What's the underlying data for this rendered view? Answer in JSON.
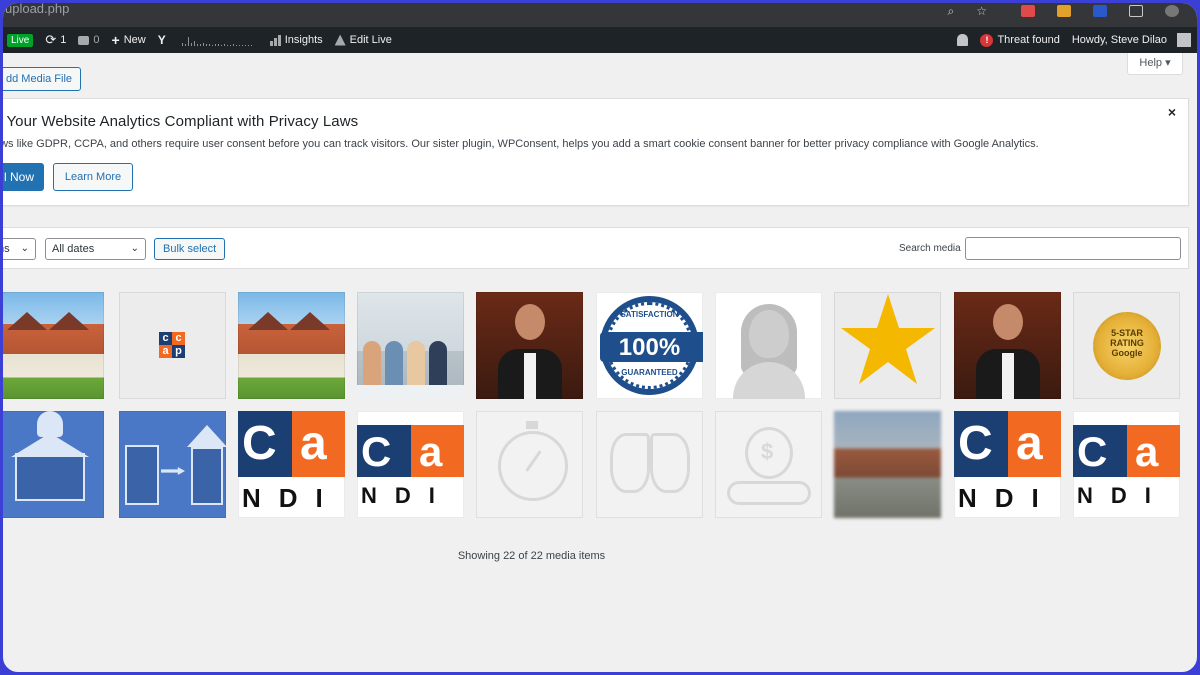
{
  "browser": {
    "url": "upload.php"
  },
  "admin_bar": {
    "live_badge": "Live",
    "updates_count": "1",
    "comments_count": "0",
    "new_label": "New",
    "insights_label": "Insights",
    "edit_live_label": "Edit Live",
    "threat_label": "Threat found",
    "greeting": "Howdy, Steve Dilao"
  },
  "page": {
    "add_media_label": "dd Media File",
    "help_label": "Help ▾"
  },
  "notice": {
    "title": "e Your Website Analytics Compliant with Privacy Laws",
    "body": "aws like GDPR, CCPA, and others require user consent before you can track visitors. Our sister plugin, WPConsent, helps you add a smart cookie consent banner for better privacy compliance with Google Analytics.",
    "primary_label": "l Now",
    "secondary_label": "Learn More",
    "dismiss": "×"
  },
  "toolbar": {
    "type_filter": "ms",
    "date_filter": "All dates",
    "bulk_label": "Bulk select",
    "search_label": "Search media",
    "search_value": ""
  },
  "media_thumbnails": [
    "houses",
    "ccap-logo",
    "houses",
    "team",
    "businessman",
    "satisfaction-badge",
    "avatar",
    "star",
    "businessman",
    "five-star-seal",
    "house-hand",
    "house-upgrade",
    "cca-logo",
    "cca-logo",
    "stopwatch",
    "hands",
    "money-bag",
    "street",
    "cca-logo",
    "cca-logo"
  ],
  "badge_text": {
    "satisfaction": "SATISFACTION",
    "main": "100%",
    "guaranteed": "GUARANTEED",
    "seal": "5-STAR RATING Google"
  },
  "footer": {
    "showing": "Showing 22 of 22 media items"
  }
}
